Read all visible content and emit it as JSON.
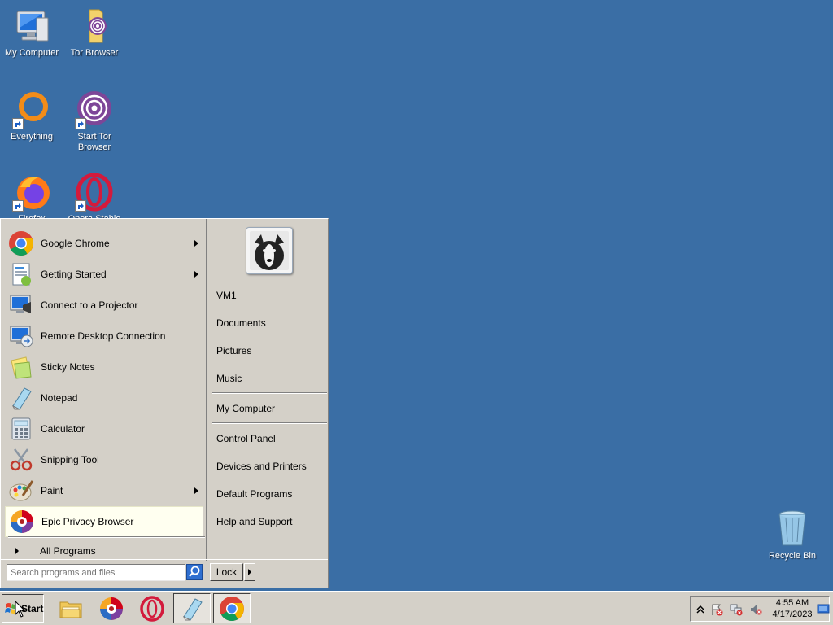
{
  "desktop": {
    "icons": [
      {
        "label": "My Computer"
      },
      {
        "label": "Tor Browser"
      },
      {
        "label": "Everything"
      },
      {
        "label": "Start Tor Browser"
      },
      {
        "label": "Firefox"
      },
      {
        "label": "Opera Stable"
      },
      {
        "label": "Recycle Bin"
      }
    ]
  },
  "start_menu": {
    "programs": [
      {
        "label": "Google Chrome",
        "icon": "chrome-icon",
        "has_submenu": true
      },
      {
        "label": "Getting Started",
        "icon": "getting-started-icon",
        "has_submenu": true
      },
      {
        "label": "Connect to a Projector",
        "icon": "projector-icon",
        "has_submenu": false
      },
      {
        "label": "Remote Desktop Connection",
        "icon": "remote-desktop-icon",
        "has_submenu": false
      },
      {
        "label": "Sticky Notes",
        "icon": "sticky-notes-icon",
        "has_submenu": false
      },
      {
        "label": "Notepad",
        "icon": "notepad-icon",
        "has_submenu": false
      },
      {
        "label": "Calculator",
        "icon": "calculator-icon",
        "has_submenu": false
      },
      {
        "label": "Snipping Tool",
        "icon": "snipping-tool-icon",
        "has_submenu": false
      },
      {
        "label": "Paint",
        "icon": "paint-icon",
        "has_submenu": true
      },
      {
        "label": "Epic Privacy Browser",
        "icon": "epic-browser-icon",
        "has_submenu": false,
        "highlighted": true
      }
    ],
    "all_programs": "All Programs",
    "right": {
      "user": "VM1",
      "documents": "Documents",
      "pictures": "Pictures",
      "music": "Music",
      "my_computer": "My Computer",
      "control_panel": "Control Panel",
      "devices_printers": "Devices and Printers",
      "default_programs": "Default Programs",
      "help_support": "Help and Support"
    },
    "search": {
      "placeholder": "Search programs and files",
      "value": ""
    },
    "lock_label": "Lock"
  },
  "taskbar": {
    "start_label": "Start",
    "pinned": [
      "file-explorer-icon",
      "epic-browser-icon",
      "opera-icon",
      "notepad-icon",
      "chrome-icon"
    ],
    "clock": {
      "time": "4:55 AM",
      "date": "4/17/2023"
    }
  },
  "colors": {
    "desktop_bg": "#3a6ea5",
    "menu_bg": "#d4d0c8",
    "highlight_bg": "#fffff0"
  }
}
